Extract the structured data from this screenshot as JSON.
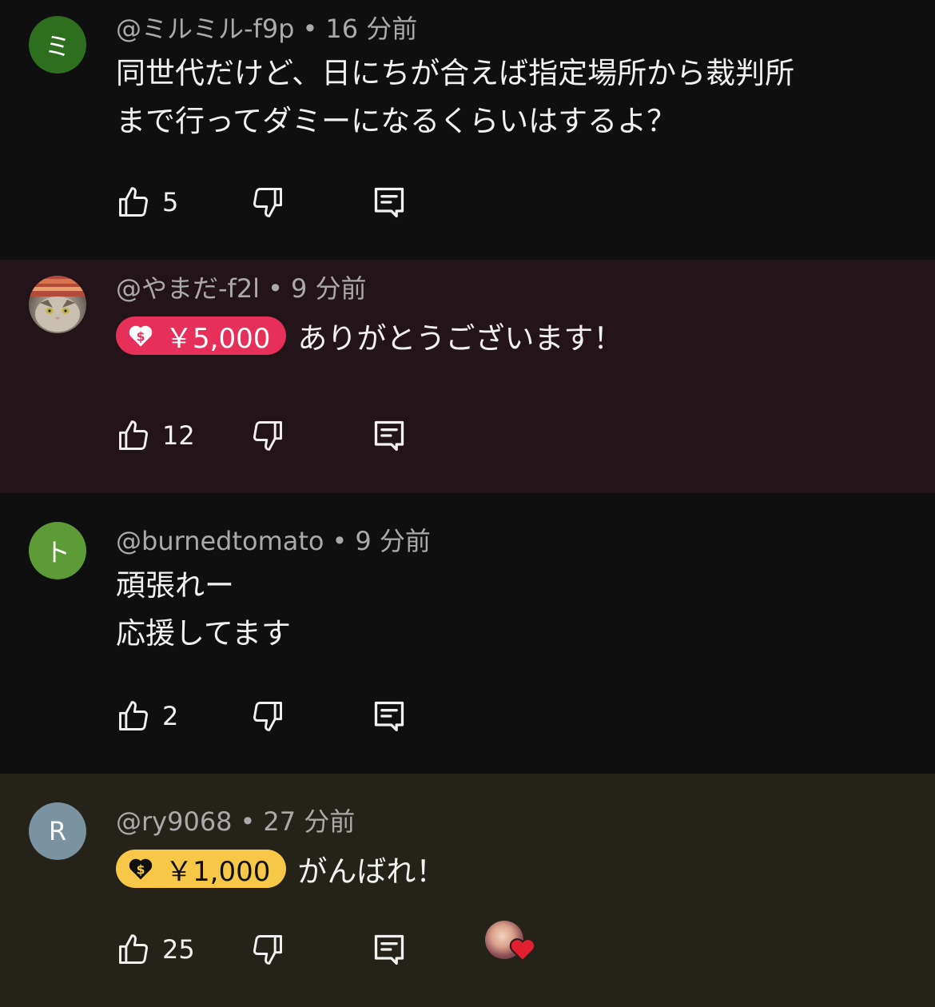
{
  "comments": [
    {
      "avatar_letter": "ミ",
      "avatar_color": "#2e6f1f",
      "author": "@ミルミル-f9p",
      "time": "16 分前",
      "text_lines": [
        "同世代だけど、日にちが合えば指定場所から裁判所",
        "まで行ってダミーになるくらいはするよ？"
      ],
      "likes": "5"
    },
    {
      "avatar_icon": "cat-photo",
      "author": "@やまだ-f2l",
      "time": "9 分前",
      "super_amount": "￥5,000",
      "super_color": "#e6305a",
      "text": "ありがとうございます！",
      "likes": "12"
    },
    {
      "avatar_letter": "ト",
      "avatar_color": "#5c9b36",
      "author": "@burnedtomato",
      "time": "9 分前",
      "text_lines": [
        "頑張れー",
        "応援してます"
      ],
      "likes": "2"
    },
    {
      "avatar_letter": "R",
      "avatar_color": "#7a93a0",
      "author": "@ry9068",
      "time": "27 分前",
      "super_amount": "￥1,000",
      "super_color": "#f7c847",
      "text": "がんばれ！",
      "likes": "25",
      "creator_heart": true
    }
  ],
  "icons": {
    "like": "thumb-up-icon",
    "dislike": "thumb-down-icon",
    "reply": "reply-icon",
    "super_thanks": "super-thanks-icon",
    "creator_heart": "creator-heart-icon"
  }
}
